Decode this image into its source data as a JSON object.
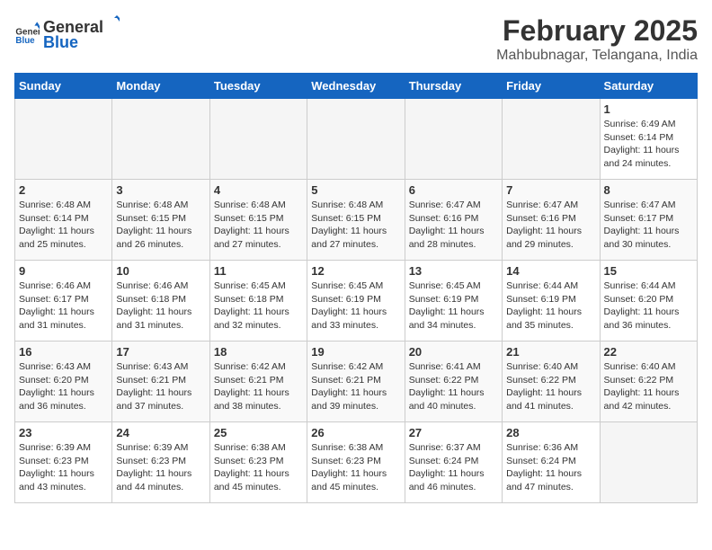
{
  "header": {
    "logo_general": "General",
    "logo_blue": "Blue",
    "title": "February 2025",
    "subtitle": "Mahbubnagar, Telangana, India"
  },
  "weekdays": [
    "Sunday",
    "Monday",
    "Tuesday",
    "Wednesday",
    "Thursday",
    "Friday",
    "Saturday"
  ],
  "weeks": [
    [
      {
        "day": "",
        "info": ""
      },
      {
        "day": "",
        "info": ""
      },
      {
        "day": "",
        "info": ""
      },
      {
        "day": "",
        "info": ""
      },
      {
        "day": "",
        "info": ""
      },
      {
        "day": "",
        "info": ""
      },
      {
        "day": "1",
        "info": "Sunrise: 6:49 AM\nSunset: 6:14 PM\nDaylight: 11 hours\nand 24 minutes."
      }
    ],
    [
      {
        "day": "2",
        "info": "Sunrise: 6:48 AM\nSunset: 6:14 PM\nDaylight: 11 hours\nand 25 minutes."
      },
      {
        "day": "3",
        "info": "Sunrise: 6:48 AM\nSunset: 6:15 PM\nDaylight: 11 hours\nand 26 minutes."
      },
      {
        "day": "4",
        "info": "Sunrise: 6:48 AM\nSunset: 6:15 PM\nDaylight: 11 hours\nand 27 minutes."
      },
      {
        "day": "5",
        "info": "Sunrise: 6:48 AM\nSunset: 6:15 PM\nDaylight: 11 hours\nand 27 minutes."
      },
      {
        "day": "6",
        "info": "Sunrise: 6:47 AM\nSunset: 6:16 PM\nDaylight: 11 hours\nand 28 minutes."
      },
      {
        "day": "7",
        "info": "Sunrise: 6:47 AM\nSunset: 6:16 PM\nDaylight: 11 hours\nand 29 minutes."
      },
      {
        "day": "8",
        "info": "Sunrise: 6:47 AM\nSunset: 6:17 PM\nDaylight: 11 hours\nand 30 minutes."
      }
    ],
    [
      {
        "day": "9",
        "info": "Sunrise: 6:46 AM\nSunset: 6:17 PM\nDaylight: 11 hours\nand 31 minutes."
      },
      {
        "day": "10",
        "info": "Sunrise: 6:46 AM\nSunset: 6:18 PM\nDaylight: 11 hours\nand 31 minutes."
      },
      {
        "day": "11",
        "info": "Sunrise: 6:45 AM\nSunset: 6:18 PM\nDaylight: 11 hours\nand 32 minutes."
      },
      {
        "day": "12",
        "info": "Sunrise: 6:45 AM\nSunset: 6:19 PM\nDaylight: 11 hours\nand 33 minutes."
      },
      {
        "day": "13",
        "info": "Sunrise: 6:45 AM\nSunset: 6:19 PM\nDaylight: 11 hours\nand 34 minutes."
      },
      {
        "day": "14",
        "info": "Sunrise: 6:44 AM\nSunset: 6:19 PM\nDaylight: 11 hours\nand 35 minutes."
      },
      {
        "day": "15",
        "info": "Sunrise: 6:44 AM\nSunset: 6:20 PM\nDaylight: 11 hours\nand 36 minutes."
      }
    ],
    [
      {
        "day": "16",
        "info": "Sunrise: 6:43 AM\nSunset: 6:20 PM\nDaylight: 11 hours\nand 36 minutes."
      },
      {
        "day": "17",
        "info": "Sunrise: 6:43 AM\nSunset: 6:21 PM\nDaylight: 11 hours\nand 37 minutes."
      },
      {
        "day": "18",
        "info": "Sunrise: 6:42 AM\nSunset: 6:21 PM\nDaylight: 11 hours\nand 38 minutes."
      },
      {
        "day": "19",
        "info": "Sunrise: 6:42 AM\nSunset: 6:21 PM\nDaylight: 11 hours\nand 39 minutes."
      },
      {
        "day": "20",
        "info": "Sunrise: 6:41 AM\nSunset: 6:22 PM\nDaylight: 11 hours\nand 40 minutes."
      },
      {
        "day": "21",
        "info": "Sunrise: 6:40 AM\nSunset: 6:22 PM\nDaylight: 11 hours\nand 41 minutes."
      },
      {
        "day": "22",
        "info": "Sunrise: 6:40 AM\nSunset: 6:22 PM\nDaylight: 11 hours\nand 42 minutes."
      }
    ],
    [
      {
        "day": "23",
        "info": "Sunrise: 6:39 AM\nSunset: 6:23 PM\nDaylight: 11 hours\nand 43 minutes."
      },
      {
        "day": "24",
        "info": "Sunrise: 6:39 AM\nSunset: 6:23 PM\nDaylight: 11 hours\nand 44 minutes."
      },
      {
        "day": "25",
        "info": "Sunrise: 6:38 AM\nSunset: 6:23 PM\nDaylight: 11 hours\nand 45 minutes."
      },
      {
        "day": "26",
        "info": "Sunrise: 6:38 AM\nSunset: 6:23 PM\nDaylight: 11 hours\nand 45 minutes."
      },
      {
        "day": "27",
        "info": "Sunrise: 6:37 AM\nSunset: 6:24 PM\nDaylight: 11 hours\nand 46 minutes."
      },
      {
        "day": "28",
        "info": "Sunrise: 6:36 AM\nSunset: 6:24 PM\nDaylight: 11 hours\nand 47 minutes."
      },
      {
        "day": "",
        "info": ""
      }
    ]
  ]
}
